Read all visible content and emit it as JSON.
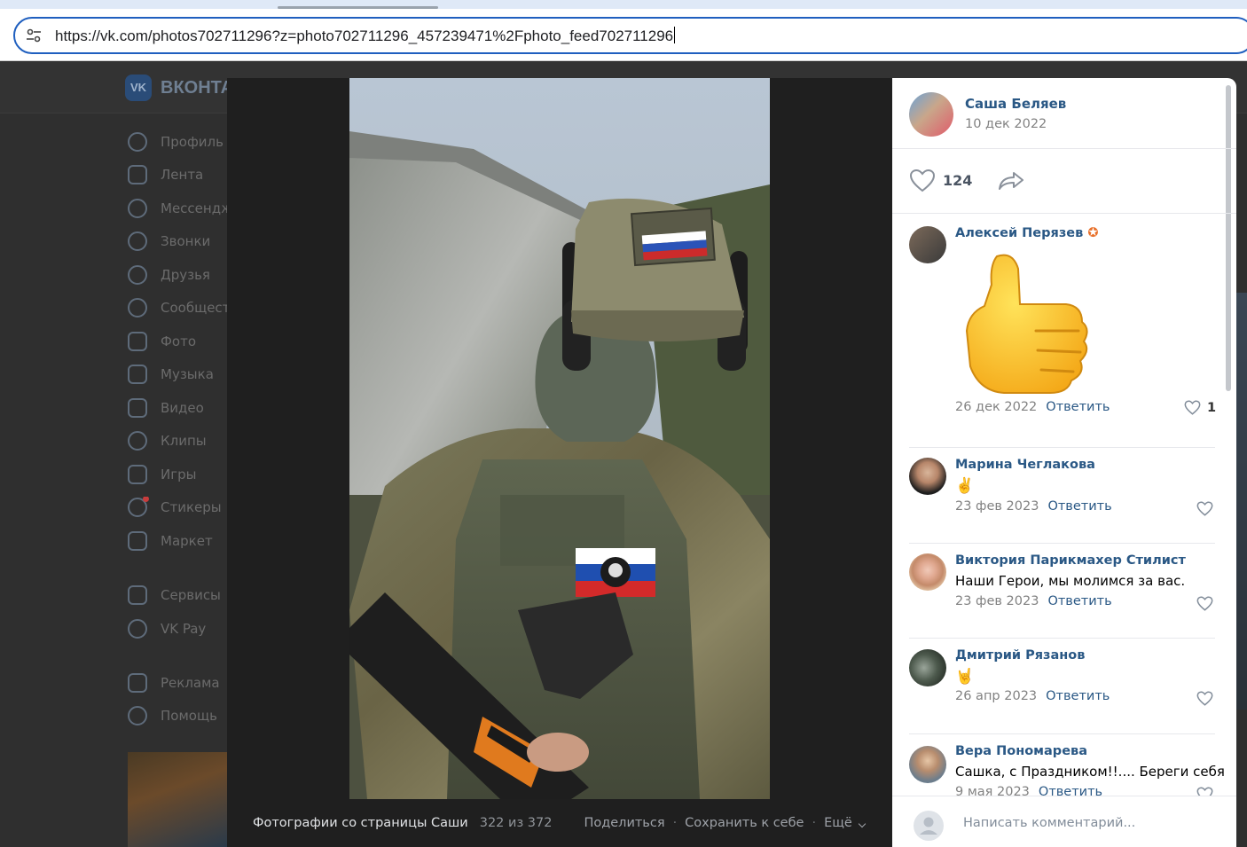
{
  "browser": {
    "url": "https://vk.com/photos702711296?z=photo702711296_457239471%2Fphoto_feed702711296"
  },
  "vk": {
    "logo_text": "ВКОНТА",
    "nav": [
      {
        "label": "Профиль",
        "icon": "profile-icon"
      },
      {
        "label": "Лента",
        "icon": "feed-icon"
      },
      {
        "label": "Мессенджер",
        "icon": "messenger-icon"
      },
      {
        "label": "Звонки",
        "icon": "phone-icon"
      },
      {
        "label": "Друзья",
        "icon": "friends-icon"
      },
      {
        "label": "Сообщества",
        "icon": "communities-icon"
      },
      {
        "label": "Фото",
        "icon": "photo-icon"
      },
      {
        "label": "Музыка",
        "icon": "music-icon"
      },
      {
        "label": "Видео",
        "icon": "video-icon"
      },
      {
        "label": "Клипы",
        "icon": "clips-icon"
      },
      {
        "label": "Игры",
        "icon": "gamepad-icon"
      },
      {
        "label": "Стикеры",
        "icon": "sticker-icon"
      },
      {
        "label": "Маркет",
        "icon": "market-bag-icon"
      },
      {
        "label": "Сервисы",
        "icon": "services-grid-icon"
      },
      {
        "label": "VK Pay",
        "icon": "vkpay-icon"
      },
      {
        "label": "Реклама",
        "icon": "megaphone-icon"
      },
      {
        "label": "Помощь",
        "icon": "help-icon"
      }
    ]
  },
  "viewer": {
    "footer": {
      "album_title": "Фотографии со страницы Саши",
      "counter": "322 из 372",
      "share": "Поделиться",
      "save": "Сохранить к себе",
      "more": "Ещё"
    }
  },
  "post": {
    "author": "Саша Беляев",
    "date": "10 дек 2022",
    "likes": "124"
  },
  "comments": [
    {
      "name": "Алексей Перязев",
      "text": "",
      "sticker": "thumbs-up",
      "date": "26 дек 2022",
      "reply": "Ответить",
      "likes": "1"
    },
    {
      "name": "Марина Чеглакова",
      "text": "✌️",
      "date": "23 фев 2023",
      "reply": "Ответить",
      "likes": ""
    },
    {
      "name": "Виктория Парикмахер Стилист",
      "text": "Наши Герои, мы молимся за вас.",
      "date": "23 фев 2023",
      "reply": "Ответить",
      "likes": ""
    },
    {
      "name": "Дмитрий Рязанов",
      "text": "🤘",
      "date": "26 апр 2023",
      "reply": "Ответить",
      "likes": ""
    },
    {
      "name": "Вера Пономарева",
      "text": "Сашка, с Праздником!!.... Береги себя",
      "date": "9 мая 2023",
      "reply": "Ответить",
      "likes": ""
    }
  ],
  "compose": {
    "placeholder": "Написать комментарий..."
  },
  "colors": {
    "link": "#2a5885",
    "muted": "#828282",
    "accent": "#1f5fbf"
  }
}
